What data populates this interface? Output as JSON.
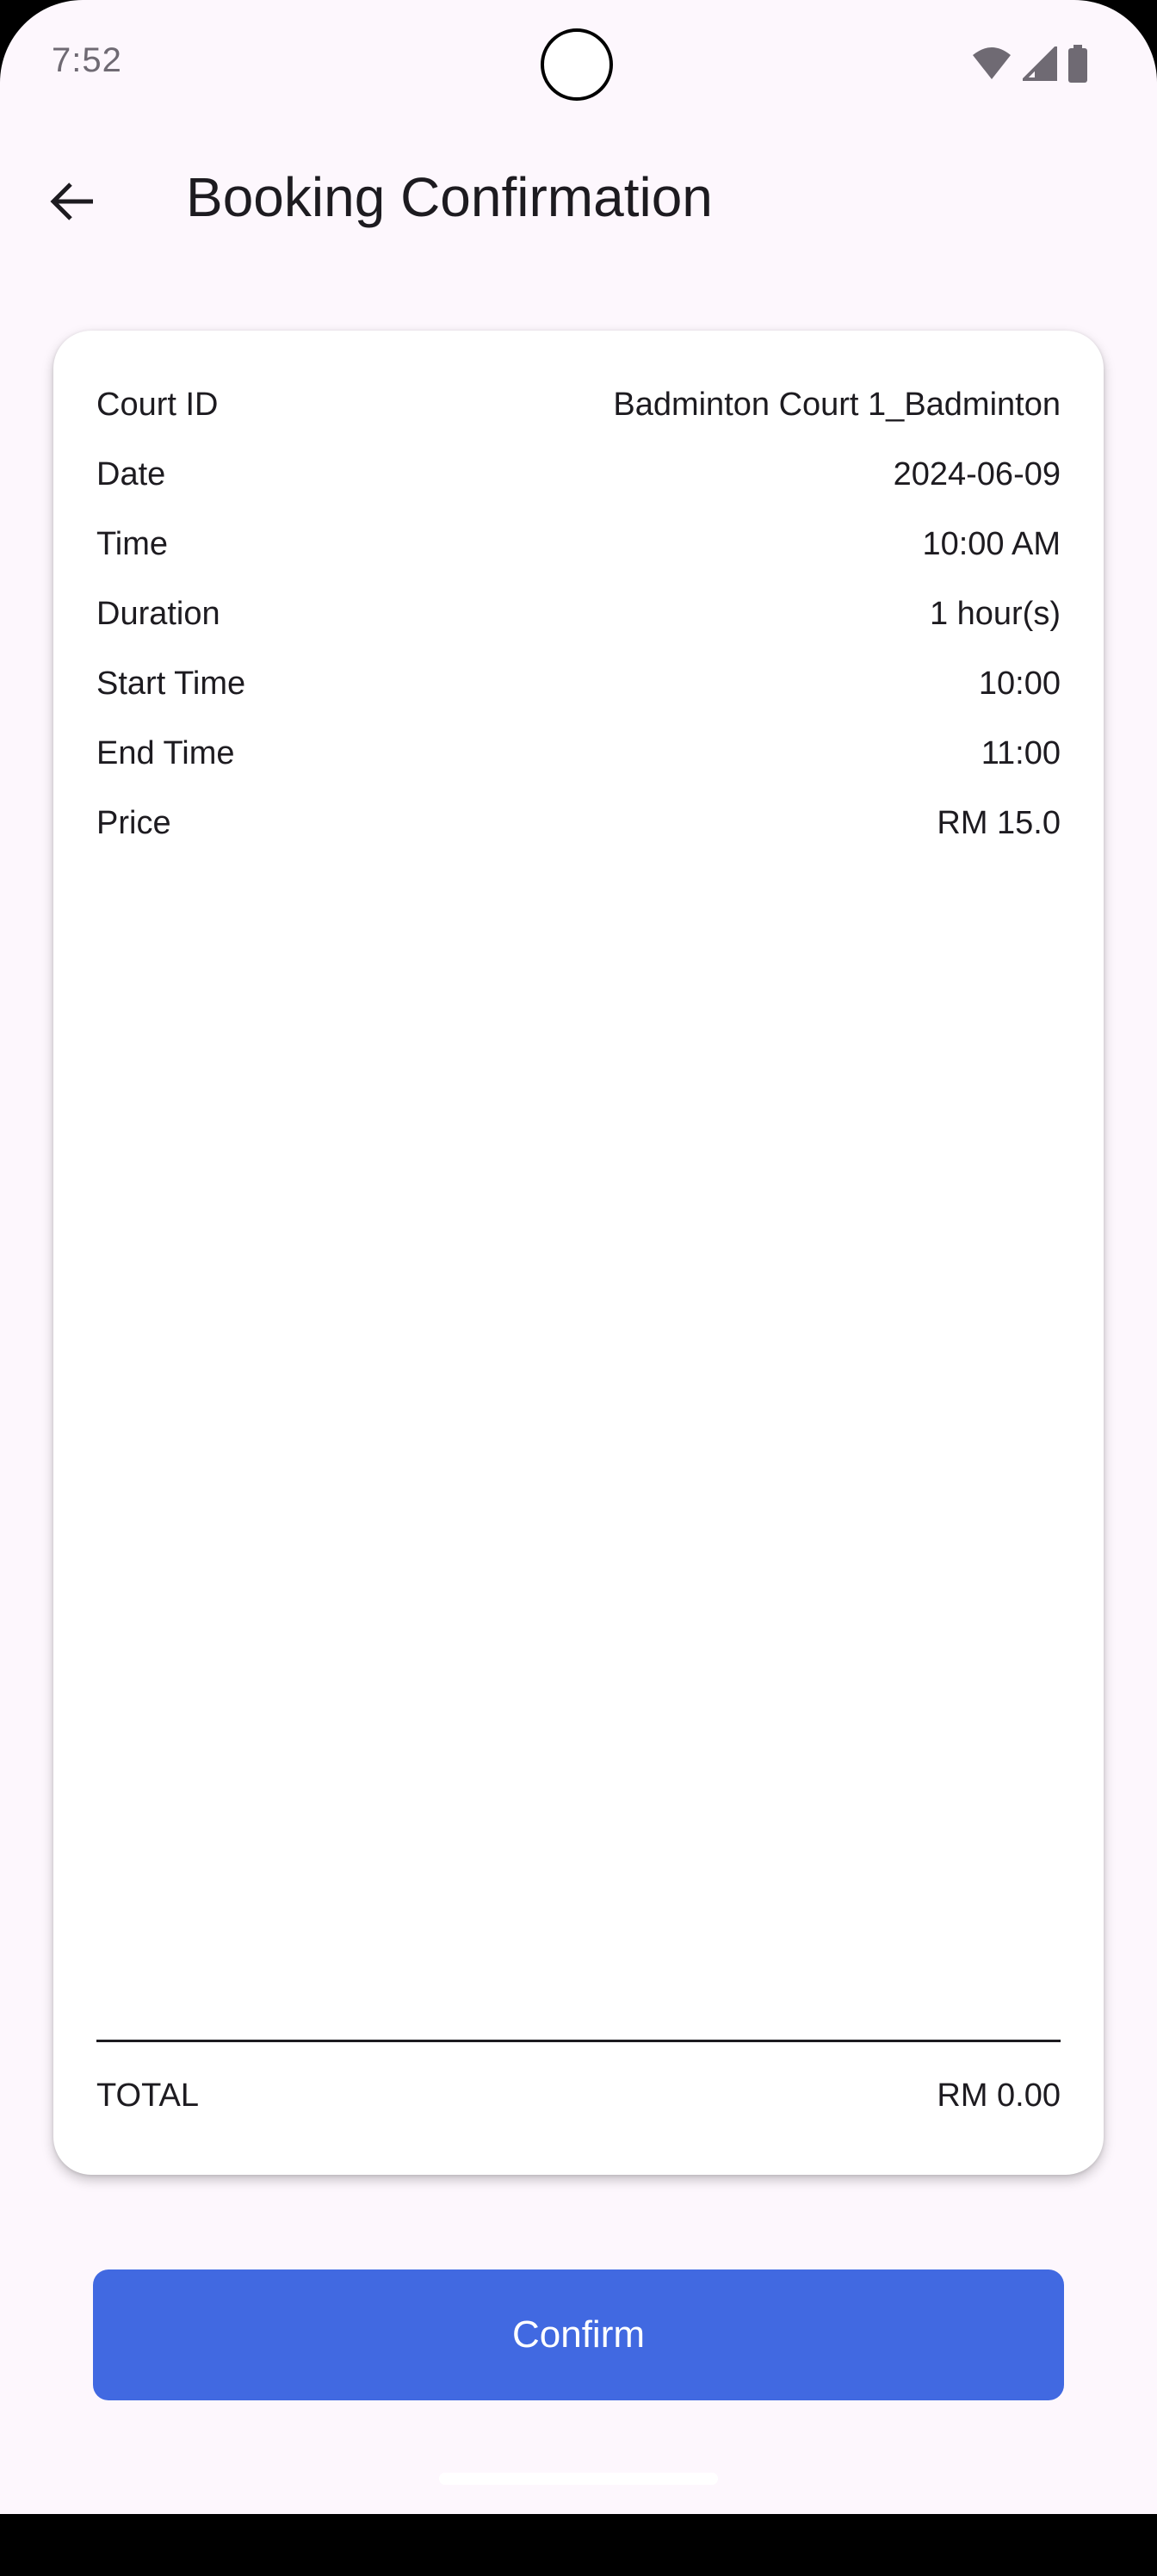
{
  "status_bar": {
    "time": "7:52",
    "icons": [
      "wifi-icon",
      "cellular-signal-icon",
      "battery-icon"
    ]
  },
  "app_bar": {
    "back_icon": "arrow-back-icon",
    "title": "Booking Confirmation"
  },
  "details": [
    {
      "label": "Court ID",
      "value": "Badminton Court 1_Badminton"
    },
    {
      "label": "Date",
      "value": "2024-06-09"
    },
    {
      "label": "Time",
      "value": "10:00 AM"
    },
    {
      "label": "Duration",
      "value": "1 hour(s)"
    },
    {
      "label": "Start Time",
      "value": "10:00"
    },
    {
      "label": "End Time",
      "value": "11:00"
    },
    {
      "label": "Price",
      "value": "RM 15.0"
    }
  ],
  "total": {
    "label": "TOTAL",
    "value": "RM 0.00"
  },
  "confirm_button": {
    "label": "Confirm",
    "color": "#4169e1"
  },
  "colors": {
    "background": "#fdf7fd",
    "card": "#ffffff",
    "text": "#1d1b20"
  }
}
